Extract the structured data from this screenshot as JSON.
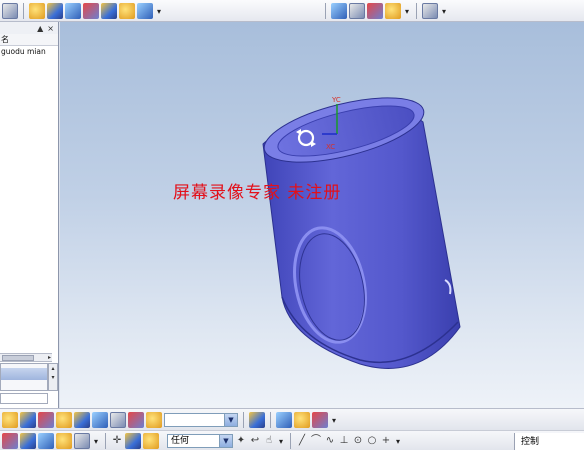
{
  "left_panel": {
    "column_header": "名",
    "header_buttons": [
      "▲",
      "×"
    ],
    "rows": [
      "guodu  mian"
    ]
  },
  "viewport": {
    "axis_y_label": "YC",
    "axis_x_label": "XC",
    "watermark": "屏幕录像专家  未注册",
    "model_color": "#5a5fd0",
    "background_top": "#a8bedb"
  },
  "bottom_toolbar": {
    "filter_value": "任何",
    "control_label": "控制"
  },
  "icons": {
    "top": [
      "view-icon",
      "render-icon",
      "layer-icon",
      "camera-icon"
    ],
    "bottom": [
      "snap-point-icon",
      "selection-filter-icon",
      "line-icon",
      "circle-icon",
      "plus-icon"
    ]
  }
}
